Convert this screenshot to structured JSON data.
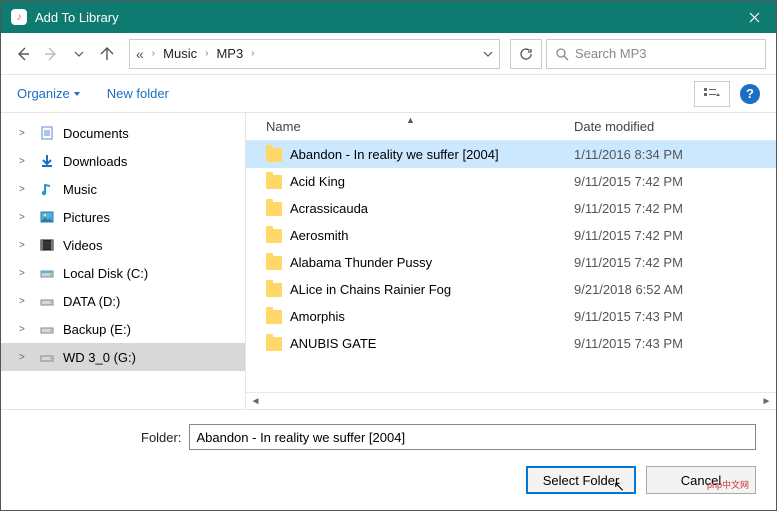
{
  "window": {
    "title": "Add To Library"
  },
  "breadcrumb": {
    "root_icon": "«",
    "items": [
      "Music",
      "MP3"
    ]
  },
  "search": {
    "placeholder": "Search MP3"
  },
  "commandbar": {
    "organize": "Organize",
    "new_folder": "New folder"
  },
  "columns": {
    "name": "Name",
    "date": "Date modified"
  },
  "tree": [
    {
      "icon": "doc",
      "label": "Documents",
      "exp": ">"
    },
    {
      "icon": "down",
      "label": "Downloads",
      "exp": ">"
    },
    {
      "icon": "music",
      "label": "Music",
      "exp": ">"
    },
    {
      "icon": "pic",
      "label": "Pictures",
      "exp": ">"
    },
    {
      "icon": "vid",
      "label": "Videos",
      "exp": ">"
    },
    {
      "icon": "disk",
      "label": "Local Disk (C:)",
      "exp": ">"
    },
    {
      "icon": "drive",
      "label": "DATA (D:)",
      "exp": ">"
    },
    {
      "icon": "drive",
      "label": "Backup (E:)",
      "exp": ">"
    },
    {
      "icon": "drive",
      "label": "WD 3_0 (G:)",
      "exp": ">",
      "selected": true
    }
  ],
  "files": [
    {
      "name": "Abandon - In reality we suffer [2004]",
      "date": "1/11/2016 8:34 PM",
      "selected": true
    },
    {
      "name": "Acid King",
      "date": "9/11/2015 7:42 PM"
    },
    {
      "name": "Acrassicauda",
      "date": "9/11/2015 7:42 PM"
    },
    {
      "name": "Aerosmith",
      "date": "9/11/2015 7:42 PM"
    },
    {
      "name": "Alabama Thunder Pussy",
      "date": "9/11/2015 7:42 PM"
    },
    {
      "name": "ALice in Chains Rainier Fog",
      "date": "9/21/2018 6:52 AM"
    },
    {
      "name": "Amorphis",
      "date": "9/11/2015 7:43 PM"
    },
    {
      "name": "ANUBIS GATE",
      "date": "9/11/2015 7:43 PM"
    }
  ],
  "footer": {
    "folder_label": "Folder:",
    "folder_value": "Abandon - In reality we suffer [2004]",
    "select_btn": "Select Folder",
    "cancel_btn": "Cancel"
  },
  "watermark": "php中文网"
}
